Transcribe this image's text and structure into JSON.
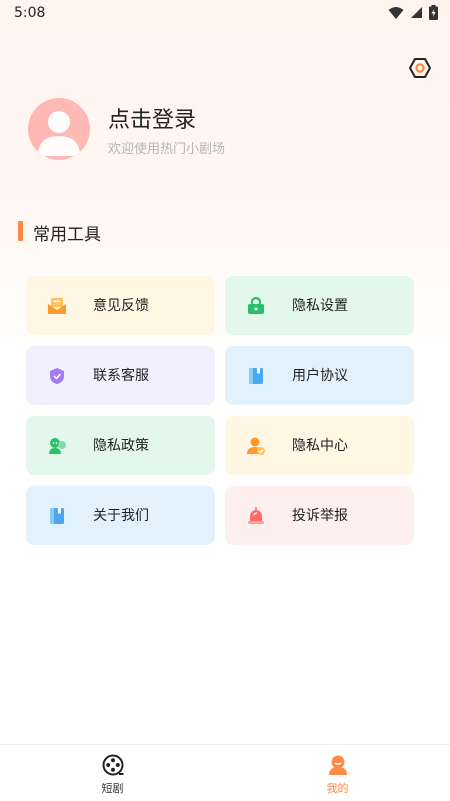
{
  "status_bar": {
    "time": "5:08"
  },
  "profile": {
    "title": "点击登录",
    "subtitle": "欢迎使用热门小剧场"
  },
  "section": {
    "title": "常用工具"
  },
  "tools": [
    {
      "label": "意见反馈",
      "icon": "feedback-mail-icon",
      "bg": "#fff7e3"
    },
    {
      "label": "隐私设置",
      "icon": "lock-icon",
      "bg": "#e4f7ec"
    },
    {
      "label": "联系客服",
      "icon": "shield-icon",
      "bg": "#f2f0ff"
    },
    {
      "label": "用户协议",
      "icon": "book-icon",
      "bg": "#e3f1fd"
    },
    {
      "label": "隐私政策",
      "icon": "chat-user-icon",
      "bg": "#e4f7ec"
    },
    {
      "label": "隐私中心",
      "icon": "user-check-icon",
      "bg": "#fff7e3"
    },
    {
      "label": "关于我们",
      "icon": "book-icon",
      "bg": "#e3f1fd"
    },
    {
      "label": "投诉举报",
      "icon": "alarm-icon",
      "bg": "#fff0f0"
    }
  ],
  "tabbar": {
    "items": [
      {
        "label": "短剧",
        "icon": "film-reel-icon",
        "active": false
      },
      {
        "label": "我的",
        "icon": "user-profile-icon",
        "active": true
      }
    ]
  },
  "colors": {
    "accent": "#ff8a44",
    "inactive_tab": "#333333",
    "active_tab": "#ff8a44"
  }
}
